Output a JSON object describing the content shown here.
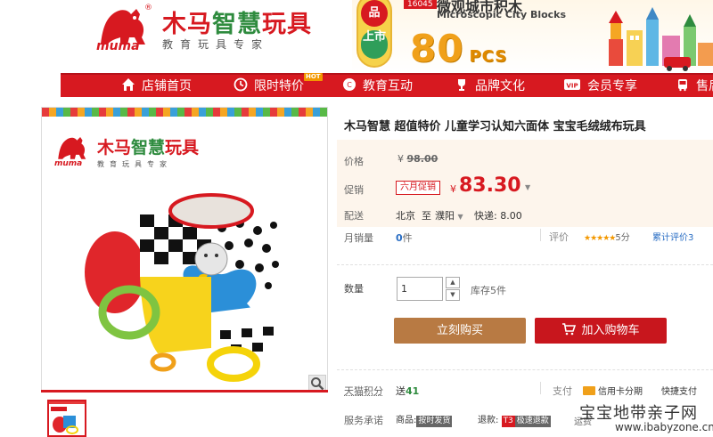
{
  "header": {
    "logo_cn": "木马智慧玩具",
    "logo_cn_red": "木马",
    "logo_cn_green": "智慧",
    "logo_cn_red2": "玩具",
    "logo_tagline": "教育玩具专家",
    "logo_mark": "muma",
    "logo_reg": "®"
  },
  "banner": {
    "badge_top": "品",
    "badge_bottom": "上市",
    "code": "16045",
    "title_cn": "微观城市积木",
    "title_en": "Microscopic City Blocks",
    "big_number": "80",
    "big_unit": "PCS"
  },
  "nav": {
    "items": [
      {
        "label": "店铺首页",
        "icon": "home-icon"
      },
      {
        "label": "限时特价",
        "icon": "clock-icon"
      },
      {
        "label": "教育互动",
        "icon": "chat-icon"
      },
      {
        "label": "品牌文化",
        "icon": "trophy-icon"
      },
      {
        "label": "会员专享",
        "icon": "vip-icon"
      },
      {
        "label": "售后",
        "icon": "bus-icon"
      }
    ],
    "hot_badge": "HOT"
  },
  "gallery": {
    "logo_cn_red": "木马",
    "logo_cn_green": "智慧",
    "logo_cn_red2": "玩具",
    "logo_tagline": "教育玩具专家",
    "logo_mark": "muma"
  },
  "product": {
    "title": "木马智慧 超值特价 儿童学习认知六面体 宝宝毛绒绒布玩具",
    "price_label": "价格",
    "currency": "¥",
    "original_price": "98.00",
    "promo_label": "促销",
    "promo_tag": "六月促销",
    "promo_price": "83.30",
    "delivery_label": "配送",
    "delivery_from": "北京",
    "delivery_to_word": "至",
    "delivery_to": "濮阳",
    "delivery_fee": "快递: 8.00",
    "monthly_sales_label": "月销量",
    "monthly_sales_value": "0",
    "monthly_sales_unit": "件",
    "rating_label": "评价",
    "rating_stars": "★★★★★",
    "rating_score": "5分",
    "review_count": "累计评价3",
    "quantity_label": "数量",
    "quantity_value": "1",
    "stock": "库存5件",
    "buy_now": "立刻购买",
    "add_to_cart": "加入购物车",
    "points_label": "天猫积分",
    "points_prefix": "送",
    "points_value": "41",
    "pay_label": "支付",
    "pay_card": "信用卡分期",
    "pay_express": "快捷支付",
    "service_label": "服务承诺",
    "service_goods": "商品:",
    "service_goods_badge": "按时发货",
    "service_refund": "退款:",
    "service_refund_icon": "T3",
    "service_refund_badge": "极速退款",
    "service_more": "运费"
  },
  "watermark": {
    "cn": "宝宝地带亲子网",
    "en": "www.ibabyzone.cn"
  },
  "colors": {
    "brand_red": "#d71920",
    "brand_green": "#2e8b3e",
    "buy_button": "#b87a43",
    "cart_button": "#c8161d",
    "price_panel": "#fdf5ec"
  }
}
